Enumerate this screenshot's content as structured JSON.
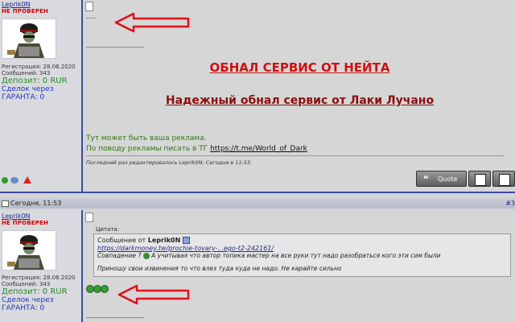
{
  "post1": {
    "author": "Leprik0N",
    "status": "НЕ ПРОВЕРЕН",
    "registration": "Регистрация: 28.06.2020",
    "messages": "Сообщений: 343",
    "deposit": "Депозит: 0 RUR",
    "deal_line1": "Сделок через",
    "deal_line2": "ГАРАНТА: 0",
    "content_dots": ".....",
    "separator": "__________________",
    "title_red": "ОБНАЛ СЕРВИС ОТ НЕЙТА",
    "title_dark": "Надежный обнал сервис от Лаки Лучано",
    "ad_line1": "Тут может быть ваша реклама.",
    "ad_line2_prefix": "По поводу рекламы писать в ТГ ",
    "ad_link": "https://t.me/World_of_Dark",
    "edited": "Последний раз редактировалось Leprik0N; Сегодня в 11:53.",
    "quote_btn": "Quote"
  },
  "post2": {
    "date": "Сегодня, 11:53",
    "number": "#3",
    "author": "Leprik0N",
    "status": "НЕ ПРОВЕРЕН",
    "registration": "Регистрация: 28.06.2020",
    "messages": "Сообщений: 343",
    "deposit": "Депозит: 0 RUR",
    "deal_line1": "Сделок через",
    "deal_line2": "ГАРАНТА: 0",
    "quote_label": "Цитата:",
    "quote_from_prefix": "Сообщение от ",
    "quote_from_user": "Leprik0N",
    "quote_link": "https://darkmoney.tw/prochie-tovary-...ego-t2-242161/",
    "quote_text1_prefix": "Совпадение ? ",
    "quote_text1": " А учитывая что автор топика мастер на все руки тут надо разобраться кого эти сим были",
    "quote_text2": "Приношу свои извинения то что влез туда куда не надо. Не карайте сильно",
    "separator": "__________________"
  },
  "colors": {
    "accent_line": "#3b4aa3",
    "arrow_red": "#e0101a",
    "unverified": "#cc0000",
    "deposit": "#2a8a2a",
    "promo_red": "#cc1111"
  }
}
